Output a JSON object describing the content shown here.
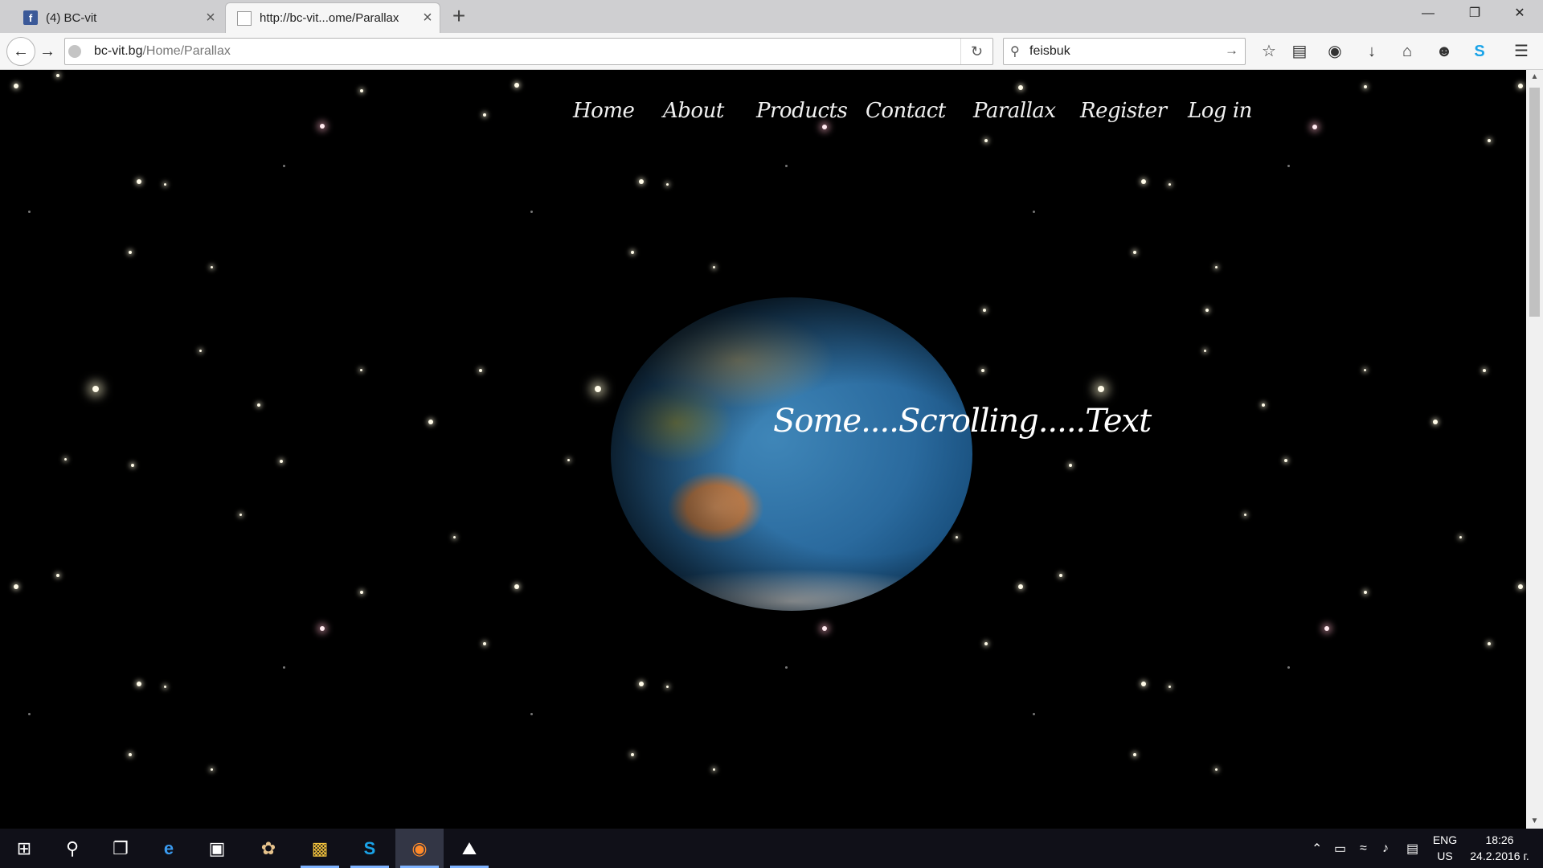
{
  "browser": {
    "tabs": [
      {
        "label": "(4) BC-vit",
        "favicon": "facebook-icon"
      },
      {
        "label": "http://bc-vit...ome/Parallax",
        "favicon": "document-icon"
      }
    ],
    "url_domain": "bc-vit.bg",
    "url_path": "/Home/Parallax",
    "search_value": "feisbuk"
  },
  "site": {
    "nav": [
      "Home",
      "About",
      "Products",
      "Contact",
      "Parallax",
      "Register",
      "Log in"
    ],
    "scrolling_text": "Some....Scrolling.....Text"
  },
  "taskbar": {
    "language": "ENG",
    "region": "US",
    "time": "18:26",
    "date": "24.2.2016 г."
  },
  "colors": {
    "page_background": "#000000",
    "nav_text": "#f0f0f0",
    "taskbar": "#101018",
    "accent": "#7fb3ff"
  }
}
